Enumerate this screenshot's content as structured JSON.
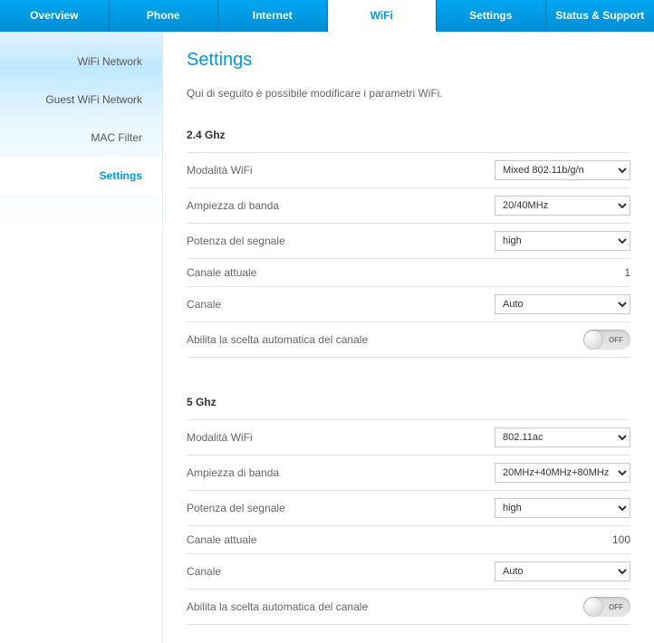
{
  "topnav": {
    "tabs": [
      {
        "label": "Overview"
      },
      {
        "label": "Phone"
      },
      {
        "label": "Internet"
      },
      {
        "label": "WiFi"
      },
      {
        "label": "Settings"
      },
      {
        "label": "Status & Support"
      }
    ],
    "active_index": 3
  },
  "sidebar": {
    "items": [
      {
        "label": "WiFi Network"
      },
      {
        "label": "Guest WiFi Network"
      },
      {
        "label": "MAC Filter"
      },
      {
        "label": "Settings"
      }
    ],
    "active_index": 3
  },
  "page": {
    "title": "Settings",
    "description": "Qui di seguito è possibile modificare i parametri WiFi."
  },
  "sections": {
    "ghz24": {
      "heading": "2.4 Ghz",
      "mode_label": "Modalità WiFi",
      "mode_value": "Mixed 802.11b/g/n",
      "bandwidth_label": "Ampiezza di banda",
      "bandwidth_value": "20/40MHz",
      "power_label": "Potenza del segnale",
      "power_value": "high",
      "curchannel_label": "Canale attuale",
      "curchannel_value": "1",
      "channel_label": "Canale",
      "channel_value": "Auto",
      "autochan_label": "Abilita la scelta automatica del canale",
      "autochan_state": "OFF"
    },
    "ghz5": {
      "heading": "5 Ghz",
      "mode_label": "Modalità WiFi",
      "mode_value": "802.11ac",
      "bandwidth_label": "Ampiezza di banda",
      "bandwidth_value": "20MHz+40MHz+80MHz",
      "power_label": "Potenza del segnale",
      "power_value": "high",
      "curchannel_label": "Canale attuale",
      "curchannel_value": "100",
      "channel_label": "Canale",
      "channel_value": "Auto",
      "autochan_label": "Abilita la scelta automatica del canale",
      "autochan_state": "OFF"
    }
  }
}
